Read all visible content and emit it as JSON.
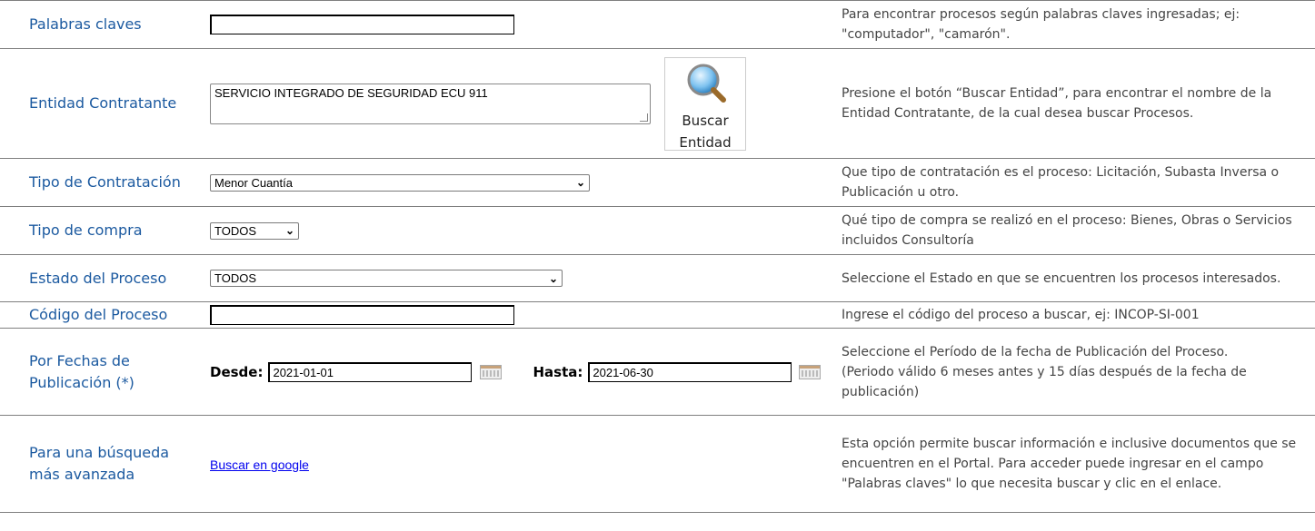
{
  "rows": {
    "keywords": {
      "label": "Palabras claves",
      "value": "",
      "help": "Para encontrar procesos según palabras claves ingresadas; ej: \"computador\", \"camarón\"."
    },
    "entity": {
      "label": "Entidad Contratante",
      "value": "SERVICIO INTEGRADO DE SEGURIDAD ECU 911",
      "button_line1": "Buscar",
      "button_line2": "Entidad",
      "help": "Presione el botón “Buscar Entidad”, para encontrar el nombre de la Entidad Contratante, de la cual desea buscar Procesos."
    },
    "contract_type": {
      "label": "Tipo de Contratación",
      "selected": "Menor Cuantía",
      "help": "Que tipo de contratación es el proceso: Licitación, Subasta Inversa o Publicación u otro."
    },
    "purchase_type": {
      "label": "Tipo de compra",
      "selected": "TODOS",
      "help": "Qué tipo de compra se realizó en el proceso: Bienes, Obras o Servicios incluidos Consultoría"
    },
    "status": {
      "label": "Estado del Proceso",
      "selected": "TODOS",
      "help": "Seleccione el Estado en que se encuentren los procesos interesados."
    },
    "code": {
      "label": "Código del Proceso",
      "value": "",
      "help": "Ingrese el código del proceso a buscar, ej: INCOP-SI-001"
    },
    "dates": {
      "label_line1": "Por Fechas de",
      "label_line2": "Publicación (*)",
      "from_label": "Desde:",
      "from_value": "2021-01-01",
      "to_label": "Hasta:",
      "to_value": "2021-06-30",
      "help_line1": "Seleccione el Período de la fecha de Publicación del Proceso.",
      "help_line2": "(Periodo válido 6 meses antes y 15 días después de la fecha de publicación)"
    },
    "advanced": {
      "label_line1": "Para una búsqueda",
      "label_line2": "más avanzada",
      "link": "Buscar en google",
      "help": "Esta opción permite buscar información e inclusive documentos que se encuentren en el Portal. Para acceder puede ingresar en el campo \"Palabras claves\" lo que necesita buscar y clic en el enlace."
    }
  },
  "icons": {
    "search": "magnifier-icon",
    "calendar": "calendar-icon",
    "dropdown": "chevron-down-icon"
  },
  "colors": {
    "label": "#1c5aa0",
    "link": "#0000ee"
  }
}
